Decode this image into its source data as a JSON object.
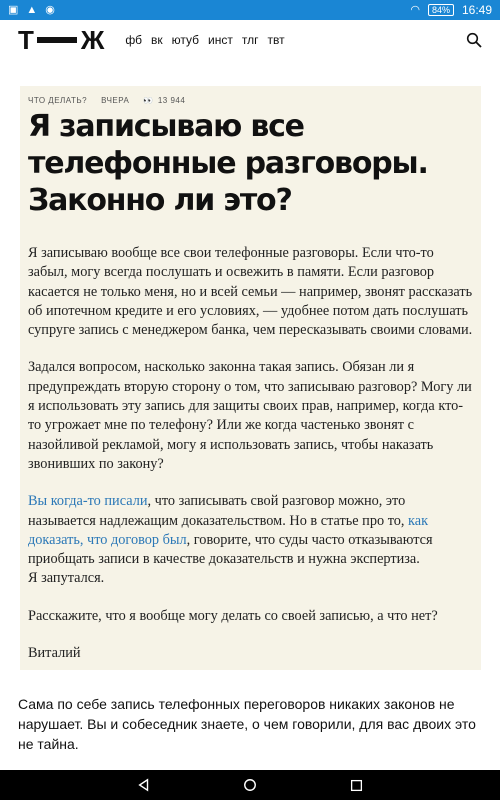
{
  "status_bar": {
    "left_icons": [
      "image-icon",
      "warning-icon",
      "android-icon"
    ],
    "battery": "84%",
    "time": "16:49"
  },
  "nav": {
    "logo_left": "Т",
    "logo_right": "Ж",
    "socials": [
      "фб",
      "вк",
      "ютуб",
      "инст",
      "тлг",
      "твт"
    ]
  },
  "article": {
    "category": "ЧТО ДЕЛАТЬ?",
    "date": "ВЧЕРА",
    "views": "13 944",
    "title": "Я записываю все телефонные разговоры. Законно ли это?",
    "p1": "Я записываю вообще все свои телефонные разговоры. Если что-то забыл, могу всегда послушать и освежить в памяти. Если разговор касается не только меня, но и всей семьи — например, звонят рассказать об ипотечном кредите и его условиях, — удобнее потом дать послушать супруге запись с менеджером банка, чем пересказывать своими словами.",
    "p2": "Задался вопросом, насколько законна такая запись. Обязан ли я предупреждать вторую сторону о том, что записываю разговор? Могу ли я использовать эту запись для защиты своих прав, например, когда кто-то угрожает мне по телефону? Или же когда частенько звонят с назойливой рекламой, могу я использовать запись, чтобы наказать звонивших по закону?",
    "p3_link1": "Вы когда-то писали",
    "p3_text1": ", что записывать свой разговор можно, это называется надлежащим доказательством. Но в статье про то, ",
    "p3_link2": "как доказать, что договор был",
    "p3_text2": ", говорите, что суды часто отказываются приобщать записи в качестве доказательств и нужна экспертиза.",
    "p3_text3": "Я запутался.",
    "p4": "Расскажите, что я вообще могу делать со своей записью, а что нет?",
    "signature": "Виталий",
    "answer": "Сама по себе запись телефонных переговоров никаких законов не нарушает. Вы и собеседник знаете, о чем говорили, для вас двоих это не тайна."
  },
  "colors": {
    "status_bar": "#1a86d4",
    "card_bg": "#f6f3e7",
    "link": "#2b78b7"
  }
}
